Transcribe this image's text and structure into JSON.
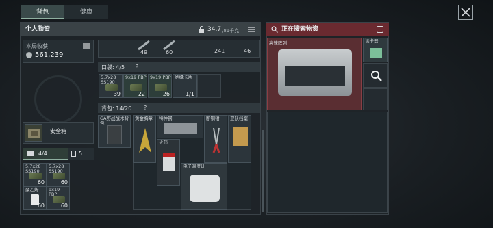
{
  "tabs": [
    {
      "label": "背包"
    },
    {
      "label": "健康"
    }
  ],
  "personal": {
    "title": "个人物资",
    "weight": "34.7",
    "weight_max": "/81千克"
  },
  "income": {
    "label": "本局收获",
    "value": "561,239"
  },
  "safe_box": {
    "label": "安全箱"
  },
  "sub_tabs": [
    {
      "label": "4/4"
    },
    {
      "label": "5"
    }
  ],
  "pockets": {
    "label": "口袋: 4/5",
    "help": "?"
  },
  "backpack": {
    "label": "背包: 14/20",
    "help": "?"
  },
  "weapon_counts": [
    {
      "value": "49"
    },
    {
      "value": "60"
    },
    {
      "value": "241"
    },
    {
      "value": "46"
    }
  ],
  "pocket_items": [
    {
      "name": "5.7x28 SS190",
      "count": "39"
    },
    {
      "name": "9x19 PBP",
      "count": "22"
    },
    {
      "name": "9x19 PBP",
      "count": "26"
    },
    {
      "name": "绝缘卡片",
      "count": "1/1"
    }
  ],
  "bag_items": [
    {
      "name": "GA野战战术背包"
    },
    {
      "name": "黄金胸章"
    },
    {
      "name": "特种钢"
    },
    {
      "name": "断钢钳"
    },
    {
      "name": "卫队档案"
    },
    {
      "name": "火药"
    },
    {
      "name": "电子温度计"
    }
  ],
  "safe_items": [
    {
      "name": "5.7x28 SS190",
      "count": "60"
    },
    {
      "name": "5.7x28 SS190",
      "count": "60"
    },
    {
      "name": "聚乙烯",
      "count": "60"
    },
    {
      "name": "9x19 PBP",
      "count": "60"
    }
  ],
  "search": {
    "title": "正在搜索物资",
    "items": [
      {
        "name": "高速阵列"
      },
      {
        "name": "读卡器"
      }
    ]
  },
  "colors": {
    "accent": "#8fb0a0",
    "red": "#8a3e44",
    "ammo": "#6b7a52"
  }
}
